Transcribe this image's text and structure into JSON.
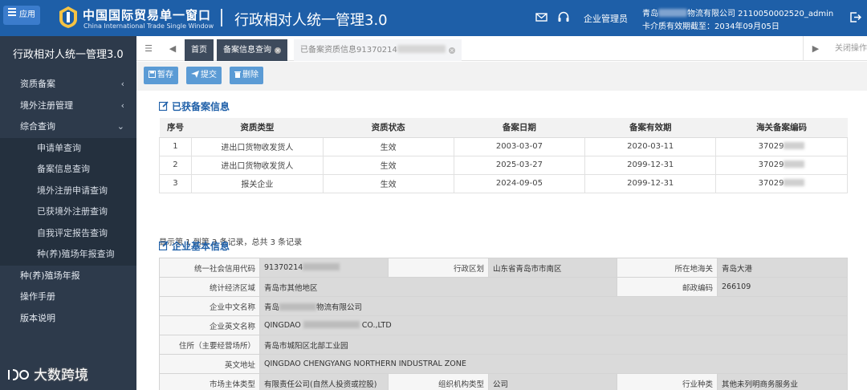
{
  "header": {
    "app_button_label": "应用",
    "logo_cn": "中国国际贸易单一窗口",
    "logo_en": "China International Trade Single Window",
    "app_title": "行政相对人统一管理3.0",
    "role": "企业管理员",
    "company_prefix": "青岛",
    "company_suffix": "物流有限公司 2110050002520_admin",
    "card_validity": "卡介质有效期截至：2034年09月05日"
  },
  "sidebar": {
    "title": "行政相对人统一管理3.0",
    "items": [
      {
        "label": "资质备案"
      },
      {
        "label": "境外注册管理"
      },
      {
        "label": "综合查询"
      }
    ],
    "sub_items": [
      {
        "label": "申请单查询"
      },
      {
        "label": "备案信息查询"
      },
      {
        "label": "境外注册申请查询"
      },
      {
        "label": "已获境外注册查询"
      },
      {
        "label": "自我评定报告查询"
      },
      {
        "label": "种(养)殖场年报查询"
      }
    ],
    "bottom_items": [
      {
        "label": "种(养)殖场年报"
      },
      {
        "label": "操作手册"
      },
      {
        "label": "版本说明"
      }
    ]
  },
  "tabs": {
    "home": "首页",
    "record_info": "备案信息查询",
    "current": "已备案资质信息91370214",
    "close_ops": "关闭操作"
  },
  "toolbar": {
    "save": "暂存",
    "submit": "提交",
    "delete": "删除"
  },
  "records_section": {
    "title": "已获备案信息",
    "columns": [
      "序号",
      "资质类型",
      "资质状态",
      "备案日期",
      "备案有效期",
      "海关备案编码"
    ],
    "rows": [
      {
        "no": "1",
        "type": "进出口货物收发货人",
        "status": "生效",
        "date": "2003-03-07",
        "valid": "2020-03-11",
        "code": "37029"
      },
      {
        "no": "2",
        "type": "进出口货物收发货人",
        "status": "生效",
        "date": "2025-03-27",
        "valid": "2099-12-31",
        "code": "37029"
      },
      {
        "no": "3",
        "type": "报关企业",
        "status": "生效",
        "date": "2024-09-05",
        "valid": "2099-12-31",
        "code": "37029"
      }
    ],
    "summary": "显示第 1 到第 3 条记录，总共 3 条记录"
  },
  "company_section": {
    "title": "企业基本信息",
    "credit_code_label": "统一社会信用代码",
    "credit_code": "91370214",
    "region_label": "行政区划",
    "region": "山东省青岛市市南区",
    "customs_label": "所在地海关",
    "customs": "青岛大港",
    "econ_region_label": "统计经济区域",
    "econ_region": "青岛市其他地区",
    "postcode_label": "邮政编码",
    "postcode": "266109",
    "name_cn_label": "企业中文名称",
    "name_cn_prefix": "青岛",
    "name_cn_suffix": "物流有限公司",
    "name_en_label": "企业英文名称",
    "name_en_prefix": "QINGDAO",
    "name_en_suffix": "CO.,LTD",
    "address_label": "住所（主要经营场所）",
    "address": "青岛市城阳区北部工业园",
    "address_en_label": "英文地址",
    "address_en": "QINGDAO CHENGYANG NORTHERN INDUSTRAL ZONE",
    "entity_type_label": "市场主体类型",
    "entity_type": "有限责任公司(自然人投资或控股)",
    "org_type_label": "组织机构类型",
    "org_type": "公司",
    "industry_label": "行业种类",
    "industry": "其他未列明商务服务业"
  },
  "watermark": "大数跨境"
}
